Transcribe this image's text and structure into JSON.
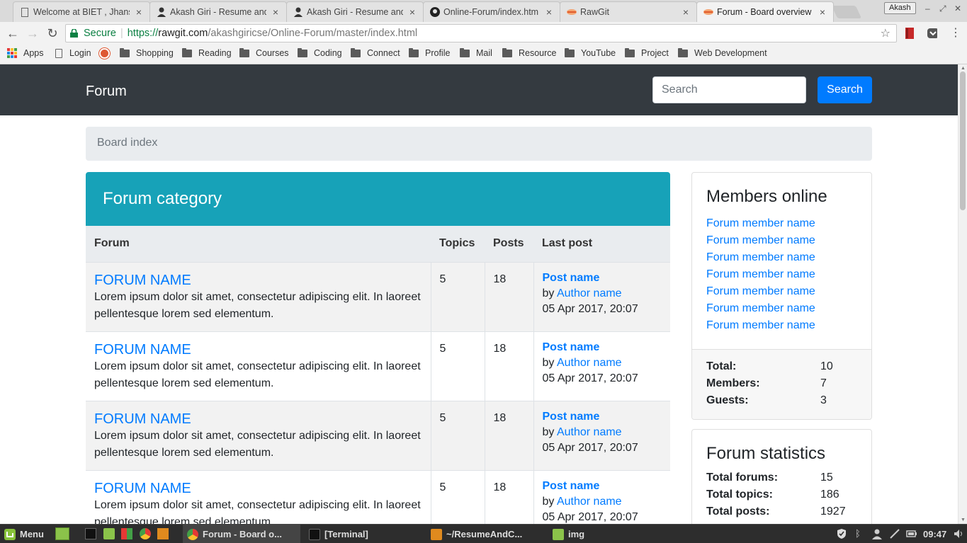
{
  "browser": {
    "tabs": [
      {
        "title": "Welcome at BIET , Jhansi",
        "close": "×"
      },
      {
        "title": "Akash Giri - Resume and",
        "close": "×"
      },
      {
        "title": "Akash Giri - Resume and",
        "close": "×"
      },
      {
        "title": "Online-Forum/index.htm",
        "close": "×"
      },
      {
        "title": "RawGit",
        "close": "×"
      },
      {
        "title": "Forum - Board overview",
        "close": "×"
      }
    ],
    "profile_name": "Akash",
    "address": {
      "secure_label": "Secure",
      "scheme": "https://",
      "host": "rawgit.com",
      "path": "/akashgiricse/Online-Forum/master/index.html"
    },
    "bookmarks": [
      "Apps",
      "Login",
      "Shopping",
      "Reading",
      "Courses",
      "Coding",
      "Connect",
      "Profile",
      "Mail",
      "Resource",
      "YouTube",
      "Project",
      "Web Development"
    ]
  },
  "site": {
    "brand": "Forum",
    "search": {
      "placeholder": "Search",
      "button": "Search"
    },
    "breadcrumb": "Board index",
    "category": {
      "title": "Forum category",
      "columns": {
        "forum": "Forum",
        "topics": "Topics",
        "posts": "Posts",
        "last_post": "Last post"
      },
      "rows": [
        {
          "name": "FORUM NAME",
          "desc": "Lorem ipsum dolor sit amet, consectetur adipiscing elit. In laoreet pellentesque lorem sed elementum.",
          "topics": "5",
          "posts": "18",
          "post_name": "Post name",
          "by": "by",
          "author": "Author name",
          "date": "05 Apr 2017, 20:07"
        },
        {
          "name": "FORUM NAME",
          "desc": "Lorem ipsum dolor sit amet, consectetur adipiscing elit. In laoreet pellentesque lorem sed elementum.",
          "topics": "5",
          "posts": "18",
          "post_name": "Post name",
          "by": "by",
          "author": "Author name",
          "date": "05 Apr 2017, 20:07"
        },
        {
          "name": "FORUM NAME",
          "desc": "Lorem ipsum dolor sit amet, consectetur adipiscing elit. In laoreet pellentesque lorem sed elementum.",
          "topics": "5",
          "posts": "18",
          "post_name": "Post name",
          "by": "by",
          "author": "Author name",
          "date": "05 Apr 2017, 20:07"
        },
        {
          "name": "FORUM NAME",
          "desc": "Lorem ipsum dolor sit amet, consectetur adipiscing elit. In laoreet pellentesque lorem sed elementum.",
          "topics": "5",
          "posts": "18",
          "post_name": "Post name",
          "by": "by",
          "author": "Author name",
          "date": "05 Apr 2017, 20:07"
        }
      ]
    },
    "members_online": {
      "title": "Members online",
      "members": [
        "Forum member name",
        "Forum member name",
        "Forum member name",
        "Forum member name",
        "Forum member name",
        "Forum member name",
        "Forum member name"
      ],
      "stats": [
        {
          "label": "Total:",
          "value": "10"
        },
        {
          "label": "Members:",
          "value": "7"
        },
        {
          "label": "Guests:",
          "value": "3"
        }
      ]
    },
    "forum_statistics": {
      "title": "Forum statistics",
      "stats": [
        {
          "label": "Total forums:",
          "value": "15"
        },
        {
          "label": "Total topics:",
          "value": "186"
        },
        {
          "label": "Total posts:",
          "value": "1927"
        }
      ]
    }
  },
  "taskbar": {
    "menu_label": "Menu",
    "windows": [
      "Forum - Board o...",
      "[Terminal]",
      "~/ResumeAndC...",
      "img"
    ],
    "clock": "09:47"
  },
  "colors": {
    "navbar": "#343a40",
    "primary": "#007bff",
    "category_header": "#17a2b8"
  }
}
